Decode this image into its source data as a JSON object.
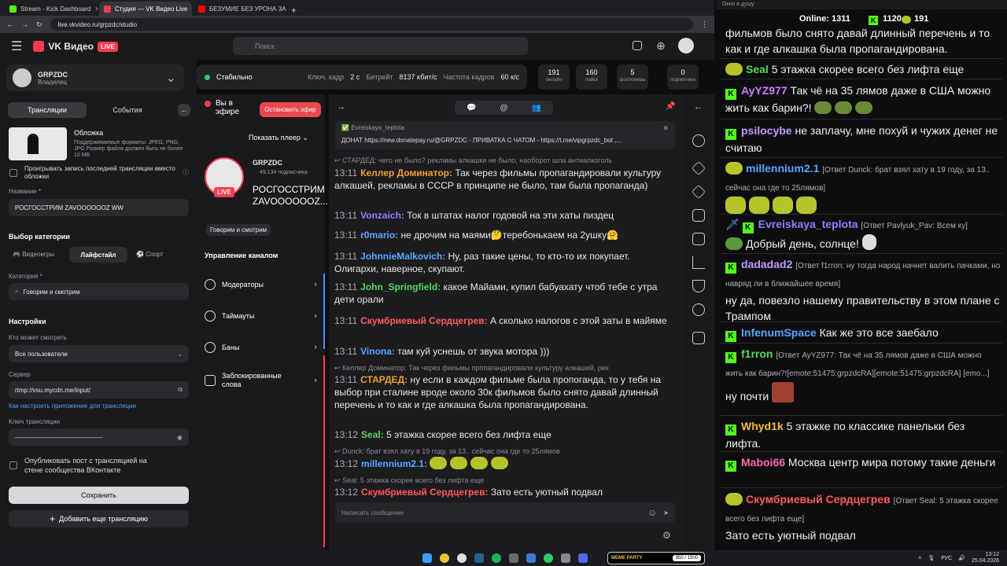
{
  "browser": {
    "tabs": [
      {
        "title": "Stream - Kick Dashboard",
        "color": "#53fc18"
      },
      {
        "title": "Студия — VK Видео Live",
        "color": "#ff3b4e"
      },
      {
        "title": "БЕЗУМИЕ БЕЗ УРОНА ЗА 4 ЧА",
        "color": "#ff0000"
      }
    ],
    "url": "live.vkvideo.ru/grpzdc/studio"
  },
  "header": {
    "logo": "VK Видео",
    "live_badge": "LIVE",
    "search_placeholder": "Поиск"
  },
  "profile": {
    "name": "GRPZDC",
    "role": "Владелец"
  },
  "status": {
    "state": "Стабильно",
    "keyframe_label": "Ключ. кадр",
    "keyframe_value": "2 с",
    "bitrate_label": "Битрейт",
    "bitrate_value": "8137 кбит/с",
    "fps_label": "Частота кадров",
    "fps_value": "60 к/с"
  },
  "stats": [
    {
      "value": "191",
      "label": "онлайн"
    },
    {
      "value": "160",
      "label": "лайки"
    },
    {
      "value": "5",
      "label": "фолловеры"
    },
    {
      "value": "0",
      "label": "подписчики"
    }
  ],
  "left": {
    "tab_streams": "Трансляции",
    "tab_events": "События",
    "cover_title": "Обложка",
    "cover_desc": "Поддерживаемые форматы: JPEG, PNG, JPG Размер файла должен быть не более 10 МБ",
    "play_last": "Проигрывать запись последней трансляции вместо обложки",
    "name_label": "Название *",
    "name_value": "РОСГОССТРИМ ZAVOOOOOOZ WW",
    "cat_title": "Выбор категории",
    "cat_tabs": [
      "Видеоигры",
      "Лайфстайл",
      "Спорт"
    ],
    "category_label": "Категория *",
    "category_value": "Говорим и смотрим",
    "settings_title": "Настройки",
    "who_label": "Кто может смотреть",
    "who_value": "Все пользователи",
    "server_label": "Сервер",
    "server_value": "rtmp://vsu.mycdn.me/input/",
    "howto_link": "Как настроить приложение для трансляции",
    "key_label": "Ключ трансляции",
    "key_value": "------------------------------------------",
    "publish_post": "Опубликовать пост с трансляцией на стене сообщества ВКонтакте",
    "save": "Сохранить",
    "add_stream": "Добавить еще трансляцию"
  },
  "middle": {
    "on_air": "Вы в эфире",
    "stop": "Остановить эфир",
    "show_player": "Показать плеер",
    "channel": "GRPZDC",
    "subs": "49,134 подписчика",
    "title": "РОСГОССТРИМ ZAVOOOOOOZ...",
    "category": "Говорим и смотрим",
    "manage": "Управление каналом",
    "menu": [
      "Модераторы",
      "Таймауты",
      "Баны",
      "Заблокированные слова"
    ]
  },
  "chat": {
    "pinned_author": "Evreiskaya_teplota",
    "pinned_text": "ДОНАТ https://new.donatepay.ru/@GRPZDC - ПРИВАТКА С ЧАТОМ - https://t.me/vipgrpzdc_bot ,...",
    "input_placeholder": "Написать сообщение",
    "messages": [
      {
        "reply": "СТАРДЕД: чего не было? рекламы алкашки не было, наоборот шла антиалкоголь"
      },
      {
        "time": "13:11",
        "author": "Келлер Доминатор:",
        "color": "#f0a030",
        "text": "Так через фильмы пропагандировали культуру алкашей, рекламы в СССР в принципе не было, там была пропаганда)"
      },
      {
        "time": "13:11",
        "author": "Vonzaich:",
        "color": "#9a7bff",
        "text": "Ток в штатах налог годовой на эти хаты пиздец"
      },
      {
        "time": "13:11",
        "author": "r0mario:",
        "color": "#58a6ff",
        "text": "не дрочим на маями🤔теребонькаем на 2ушку🤗"
      },
      {
        "time": "13:11",
        "author": "JohnnieMalkovich:",
        "color": "#58a6ff",
        "text": "Ну, раз такие цены, то кто-то их покупает. Олигархи, наверное, скупают."
      },
      {
        "time": "13:11",
        "author": "John_Springfield:",
        "color": "#53d85c",
        "text": "какое Майами, купил бабуахату чтоб тебе с утра дети орали"
      },
      {
        "time": "13:11",
        "author": "Скумбриевый Сердцегрев:",
        "color": "#ff5a5a",
        "text": "А сколько налогов с этой заты в майяме"
      },
      {
        "time": "13:11",
        "author": "Vinona:",
        "color": "#58a6ff",
        "text": "там куй уснешь от звука мотора )))"
      },
      {
        "reply": "Келлер Доминатор: Так через фильмы пропагандировали культуру алкашей, рек"
      },
      {
        "time": "13:11",
        "author": "СТАРДЕД:",
        "color": "#f0a030",
        "text": "ну если в каждом фильме была пропоганда, то у тебя на выбор при сталине вроде около 30к фильмов было снято давай длинный перечень и то как и где алкашка была пропагандирована."
      },
      {
        "time": "13:12",
        "author": "Seal:",
        "color": "#53d85c",
        "text": "5 этажка скорее всего без лифта еще"
      },
      {
        "reply": "Dunck: брат взял хату в 19 году, за 13.. сейчас она где то 25лямов"
      },
      {
        "time": "13:12",
        "author": "millennium2.1:",
        "color": "#58a6ff",
        "text": ""
      },
      {
        "reply": "Seal: 5 этажка скорее всего без лифта еще"
      },
      {
        "time": "13:12",
        "author": "Скумбриевый Сердцегрев:",
        "color": "#ff5a5a",
        "text": "Зато есть уютный подвал"
      }
    ]
  },
  "right": {
    "window_title": "Окно в душу",
    "online_label": "Online:",
    "online_value": "1311",
    "kick_count": "1120",
    "vk_count": "191",
    "messages": [
      {
        "author": "",
        "text": "фильмов было снято давай длинный перечень и то как и где алкашка была пропагандирована."
      },
      {
        "author": "Seal",
        "color": "#53d85c",
        "text": "5 этажка скорее всего без лифта еще"
      },
      {
        "author": "AyYZ977",
        "color": "#d07bff",
        "text": "Так чё на 35 лямов даже в США можно жить как барин?!"
      },
      {
        "author": "psilocybe",
        "color": "#c39bff",
        "text": "не заплачу, мне похуй и чужих денег не считаю"
      },
      {
        "author": "millennium2.1",
        "color": "#58a6ff",
        "sub": "[Ответ Dunck: брат взял хату в 19 году, за 13.. сейчас она где то 25лямов]",
        "text": ""
      },
      {
        "author": "Evreiskaya_teplota",
        "color": "#9a7bff",
        "sub": "[Ответ Pavlyuk_Pav: Всем ку]",
        "text": "Добрый день, солнце!"
      },
      {
        "author": "dadadad2",
        "color": "#c39bff",
        "sub": "[Ответ f1rron: ну тогда народ начнет валить пачками, но навряд ли в ближайшее время]",
        "text": "ну да, повезло нашему правительству в этом плане с Трампом"
      },
      {
        "author": "InfenumSpace",
        "color": "#58a6ff",
        "text": "Как же это все заебало"
      },
      {
        "author": "f1rron",
        "color": "#53d85c",
        "sub": "[Ответ AyYZ977: Так чё на 35 лямов даже в США можно жить как барин?![emote:51475:grpzdcRA][emote:51475:grpzdcRA] [emo...]",
        "text": "ну почти"
      },
      {
        "author": "Whyd1k",
        "color": "#f0c030",
        "text": "5 этажке по классике панельки без лифта."
      },
      {
        "author": "Maboi66",
        "color": "#ff6ab0",
        "text": "Москва центр мира потому такие деньги"
      },
      {
        "author": "Скумбриевый Сердцегрев",
        "color": "#ff5a5a",
        "sub": "[Ответ Seal: 5 этажка скорее всего без лифта еще]",
        "text": "Зато есть уютный подвал"
      }
    ]
  },
  "taskbar": {
    "lang": "РУС",
    "time": "13:12",
    "date": "25.04.2026",
    "widget": "MEME PARTY",
    "widget_value": "950 / 1500"
  }
}
